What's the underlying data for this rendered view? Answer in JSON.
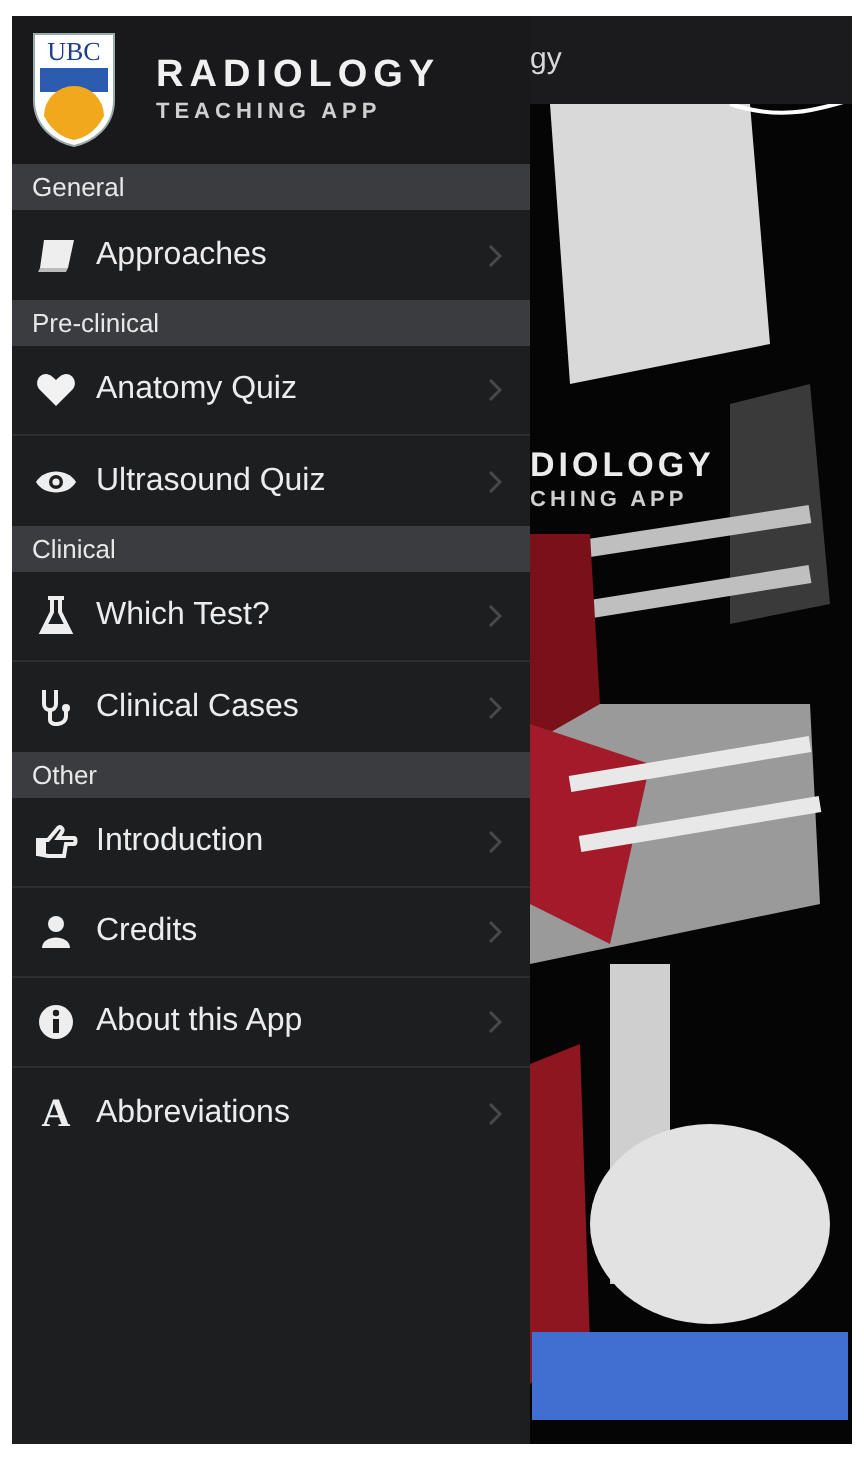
{
  "header": {
    "logo_text": "UBC",
    "title": "RADIOLOGY",
    "subtitle": "TEACHING APP"
  },
  "menu": [
    {
      "section": "General",
      "items": [
        {
          "kind": "book",
          "label": "Approaches"
        }
      ]
    },
    {
      "section": "Pre-clinical",
      "items": [
        {
          "kind": "heart",
          "label": "Anatomy Quiz"
        },
        {
          "kind": "eye",
          "label": "Ultrasound Quiz"
        }
      ]
    },
    {
      "section": "Clinical",
      "items": [
        {
          "kind": "flask",
          "label": "Which Test?"
        },
        {
          "kind": "stethoscope",
          "label": "Clinical Cases"
        }
      ]
    },
    {
      "section": "Other",
      "items": [
        {
          "kind": "hand",
          "label": "Introduction"
        },
        {
          "kind": "user",
          "label": "Credits"
        },
        {
          "kind": "info",
          "label": "About this App"
        },
        {
          "kind": "letter",
          "icon_char": "A",
          "label": "Abbreviations"
        }
      ]
    }
  ],
  "behind": {
    "nav_title": "gy",
    "splash_title": "DIOLOGY",
    "splash_subtitle": "CHING APP"
  }
}
